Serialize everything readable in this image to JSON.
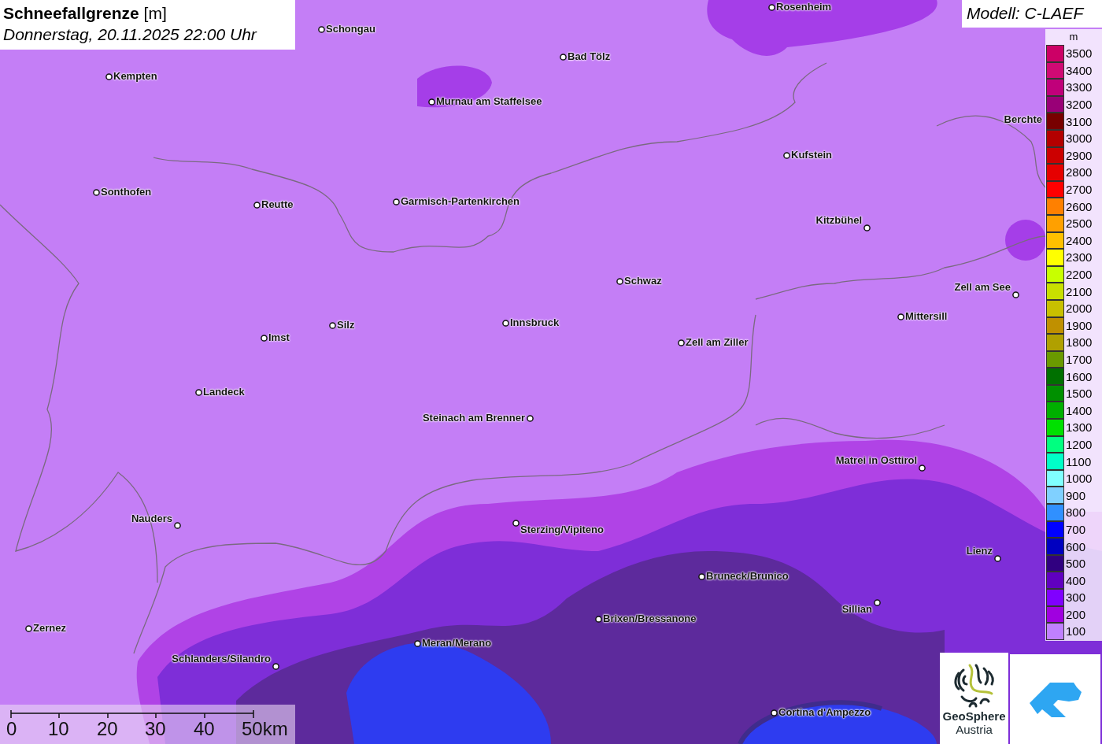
{
  "title": {
    "parameter": "Schneefallgrenze",
    "unit": "[m]",
    "datetime": "Donnerstag, 20.11.2025 22:00 Uhr"
  },
  "model": "Modell: C-LAEF",
  "legend": {
    "unit": "m",
    "entries": [
      {
        "label": "3500",
        "color": "#cc0066"
      },
      {
        "label": "3400",
        "color": "#d00a74"
      },
      {
        "label": "3300",
        "color": "#c0007a"
      },
      {
        "label": "3200",
        "color": "#990077"
      },
      {
        "label": "3100",
        "color": "#780000"
      },
      {
        "label": "3000",
        "color": "#b40000"
      },
      {
        "label": "2900",
        "color": "#cc0000"
      },
      {
        "label": "2800",
        "color": "#e60000"
      },
      {
        "label": "2700",
        "color": "#ff0000"
      },
      {
        "label": "2600",
        "color": "#ff8000"
      },
      {
        "label": "2500",
        "color": "#ffa000"
      },
      {
        "label": "2400",
        "color": "#ffc000"
      },
      {
        "label": "2300",
        "color": "#ffff00"
      },
      {
        "label": "2200",
        "color": "#c8ff00"
      },
      {
        "label": "2100",
        "color": "#c8e000"
      },
      {
        "label": "2000",
        "color": "#c8c000"
      },
      {
        "label": "1900",
        "color": "#c09000"
      },
      {
        "label": "1800",
        "color": "#b0a000"
      },
      {
        "label": "1700",
        "color": "#6a9a00"
      },
      {
        "label": "1600",
        "color": "#007000"
      },
      {
        "label": "1500",
        "color": "#009000"
      },
      {
        "label": "1400",
        "color": "#00b000"
      },
      {
        "label": "1300",
        "color": "#00e000"
      },
      {
        "label": "1200",
        "color": "#00ff80"
      },
      {
        "label": "1100",
        "color": "#00ffc8"
      },
      {
        "label": "1000",
        "color": "#80ffff"
      },
      {
        "label": "900",
        "color": "#80d0ff"
      },
      {
        "label": "800",
        "color": "#3090ff"
      },
      {
        "label": "700",
        "color": "#0000ff"
      },
      {
        "label": "600",
        "color": "#0000c0"
      },
      {
        "label": "500",
        "color": "#300080"
      },
      {
        "label": "400",
        "color": "#6000c0"
      },
      {
        "label": "300",
        "color": "#8000ff"
      },
      {
        "label": "200",
        "color": "#a000e0"
      },
      {
        "label": "100",
        "color": "#c080ff"
      }
    ]
  },
  "cities": [
    {
      "name": "Rosenheim"
    },
    {
      "name": "Schongau"
    },
    {
      "name": "Bad Tölz"
    },
    {
      "name": "Kempten"
    },
    {
      "name": "Murnau am Staffelsee"
    },
    {
      "name": "Berchte"
    },
    {
      "name": "Kufstein"
    },
    {
      "name": "Sonthofen"
    },
    {
      "name": "Reutte"
    },
    {
      "name": "Garmisch-Partenkirchen"
    },
    {
      "name": "Kitzbühel"
    },
    {
      "name": "Schwaz"
    },
    {
      "name": "Zell am See"
    },
    {
      "name": "Mittersill"
    },
    {
      "name": "Innsbruck"
    },
    {
      "name": "Silz"
    },
    {
      "name": "Imst"
    },
    {
      "name": "Zell am Ziller"
    },
    {
      "name": "Landeck"
    },
    {
      "name": "Steinach am Brenner"
    },
    {
      "name": "Matrei in Osttirol"
    },
    {
      "name": "Nauders"
    },
    {
      "name": "Sterzing/Vipiteno"
    },
    {
      "name": "Lienz"
    },
    {
      "name": "Bruneck/Brunico"
    },
    {
      "name": "Sillian"
    },
    {
      "name": "Brixen/Bressanone"
    },
    {
      "name": "Zernez"
    },
    {
      "name": "Meran/Merano"
    },
    {
      "name": "Schlanders/Silandro"
    },
    {
      "name": "Cortina d'Ampezzo"
    }
  ],
  "scale_bar": {
    "labels": [
      "0",
      "10",
      "20",
      "30",
      "40",
      "50km"
    ]
  },
  "logo": {
    "line1": "GeoSphere",
    "line2": "Austria"
  }
}
